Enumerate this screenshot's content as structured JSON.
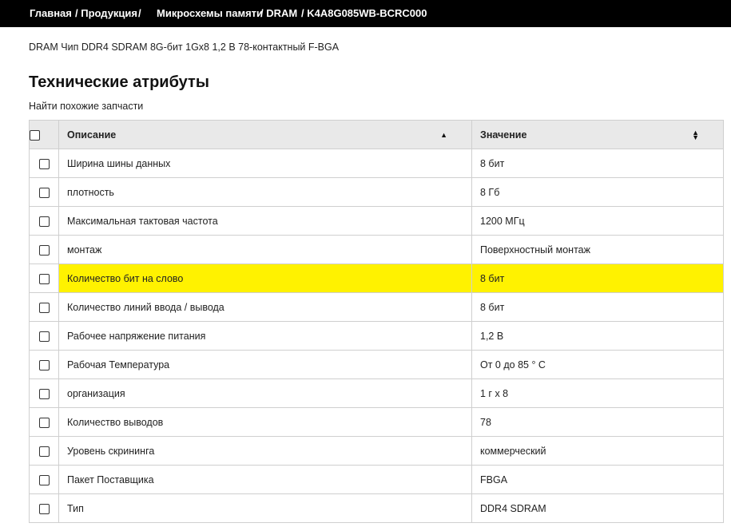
{
  "breadcrumb": {
    "home": "Главная",
    "products": "/ Продукция",
    "products_sep": "/",
    "memory": "Микросхемы памяти",
    "dram": "/ DRAM",
    "current": "/ K4A8G085WB-BCRC000"
  },
  "product": {
    "description": "DRAM Чип DDR4 SDRAM 8G-бит 1Gx8 1,2 В 78-контактный F-BGA"
  },
  "section": {
    "title": "Технические атрибуты",
    "find_similar": "Найти похожие запчасти"
  },
  "table": {
    "headers": {
      "description": "Описание",
      "value": "Значение"
    },
    "highlight_color": "#fff200",
    "rows": [
      {
        "description": "Ширина шины данных",
        "value": "8 бит"
      },
      {
        "description": "плотность",
        "value": "8 Гб"
      },
      {
        "description": "Максимальная тактовая частота",
        "value": "1200 МГц"
      },
      {
        "description": "монтаж",
        "value": "Поверхностный монтаж"
      },
      {
        "description": "Количество бит на слово",
        "value": "8 бит"
      },
      {
        "description": "Количество линий ввода / вывода",
        "value": "8 бит"
      },
      {
        "description": "Рабочее напряжение питания",
        "value": "1,2 В"
      },
      {
        "description": "Рабочая Температура",
        "value": "От 0 до 85 ° C"
      },
      {
        "description": "организация",
        "value": "1 г х 8"
      },
      {
        "description": "Количество выводов",
        "value": "78"
      },
      {
        "description": "Уровень скрининга",
        "value": "коммерческий"
      },
      {
        "description": "Пакет Поставщика",
        "value": "FBGA"
      },
      {
        "description": "Тип",
        "value": "DDR4 SDRAM"
      }
    ]
  }
}
